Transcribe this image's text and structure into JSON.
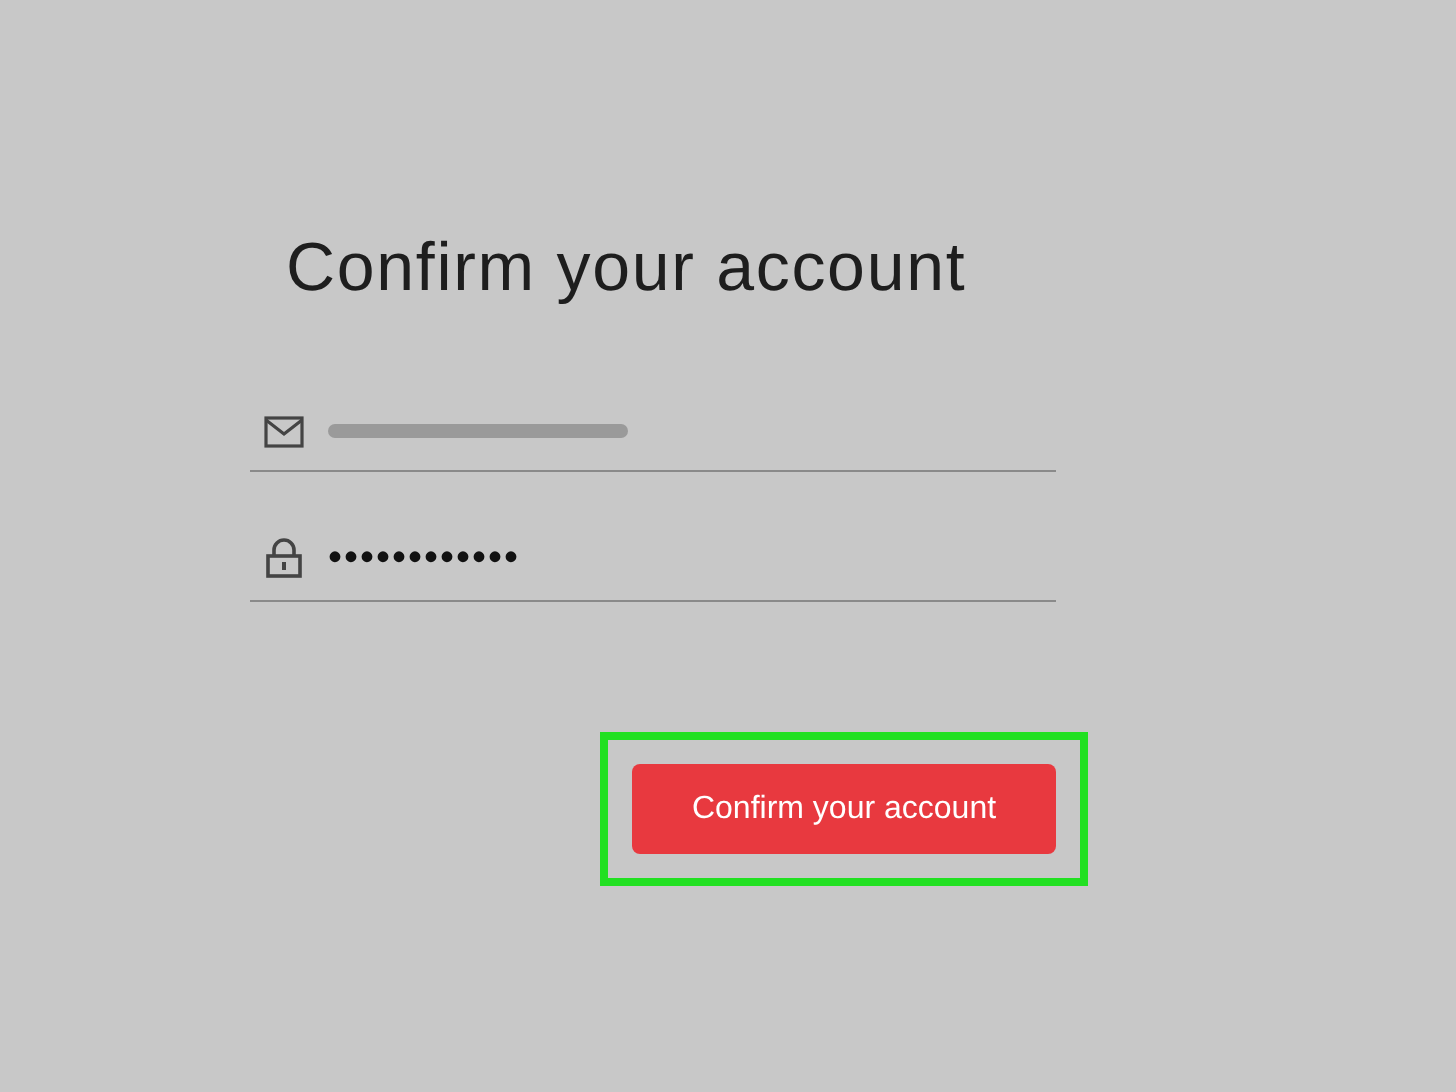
{
  "title": "Confirm your account",
  "email_field": {
    "blurred": true
  },
  "password_field": {
    "value": "••••••••••••"
  },
  "submit_button": {
    "label": "Confirm your account",
    "highlighted": true
  }
}
